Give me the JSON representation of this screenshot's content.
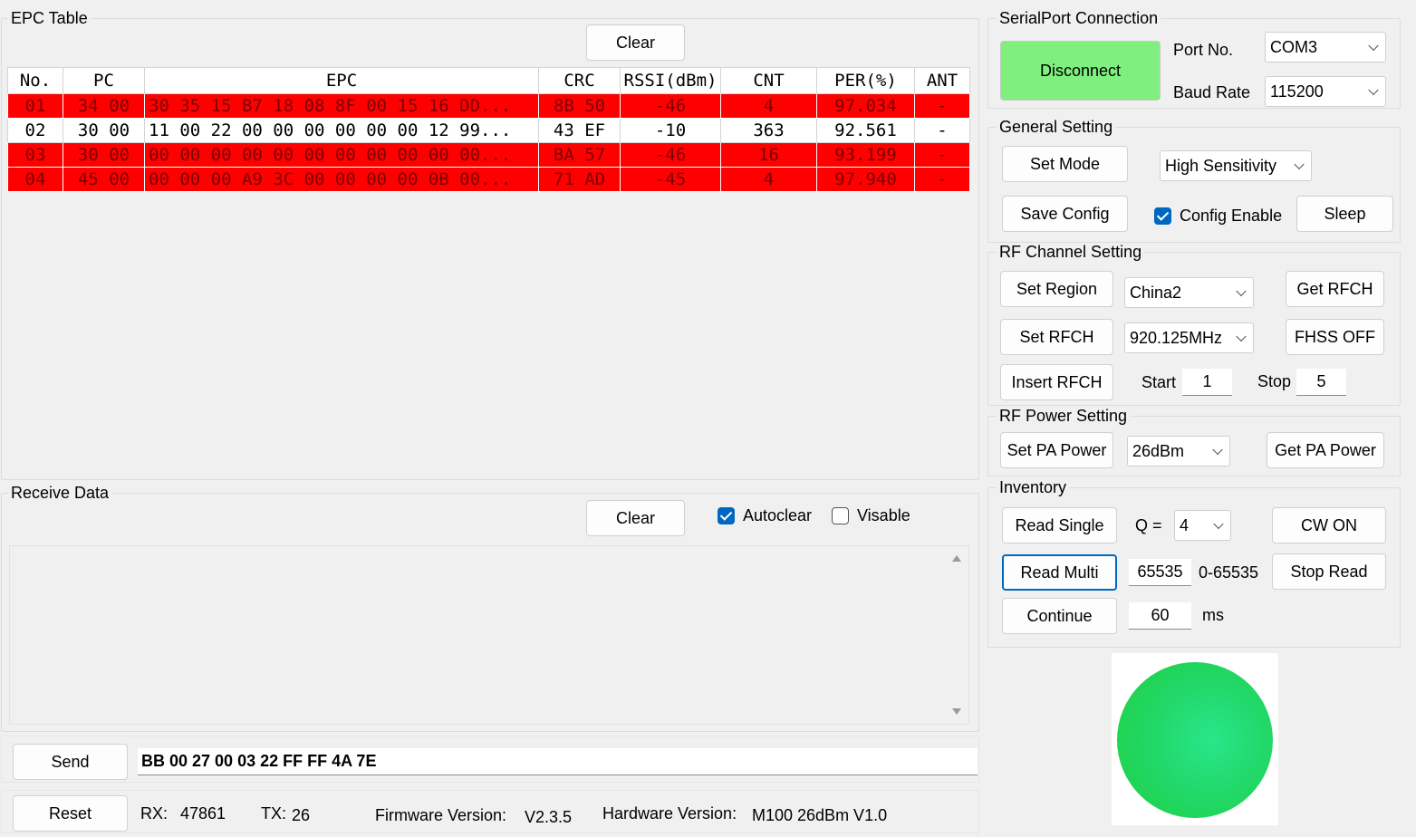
{
  "epc_table": {
    "title": "EPC Table",
    "clear_label": "Clear",
    "columns": [
      "No.",
      "PC",
      "EPC",
      "CRC",
      "RSSI(dBm)",
      "CNT",
      "PER(%)",
      "ANT"
    ],
    "rows": [
      {
        "no": "01",
        "pc": "34 00",
        "epc": "30 35 15 B7 18 08 8F 00 15 16 DD...",
        "crc": "8B 50",
        "rssi": "-46",
        "cnt": "4",
        "per": "97.034",
        "ant": "-",
        "highlight": "red"
      },
      {
        "no": "02",
        "pc": "30 00",
        "epc": "11 00 22 00 00 00 00 00 00 12 99...",
        "crc": "43 EF",
        "rssi": "-10",
        "cnt": "363",
        "per": "92.561",
        "ant": "-",
        "highlight": "none"
      },
      {
        "no": "03",
        "pc": "30 00",
        "epc": "00 00 00 00 00 00 00 00 00 00 00...",
        "crc": "BA 57",
        "rssi": "-46",
        "cnt": "16",
        "per": "93.199",
        "ant": "-",
        "highlight": "red"
      },
      {
        "no": "04",
        "pc": "45 00",
        "epc": "00 00 00 A9 3C 00 00 00 00 0B 00...",
        "crc": "71 AD",
        "rssi": "-45",
        "cnt": "4",
        "per": "97.940",
        "ant": "-",
        "highlight": "red"
      }
    ]
  },
  "receive_data": {
    "title": "Receive Data",
    "clear_label": "Clear",
    "autoclear_label": "Autoclear",
    "autoclear_checked": true,
    "visable_label": "Visable",
    "visable_checked": false,
    "content": ""
  },
  "send": {
    "send_label": "Send",
    "command": "BB 00 27 00 03 22 FF FF 4A 7E"
  },
  "status_bar": {
    "reset_label": "Reset",
    "rx_label": "RX:",
    "rx_value": "47861",
    "tx_label": "TX:",
    "tx_value": "26",
    "firmware_label": "Firmware Version:",
    "firmware_value": "V2.3.5",
    "hardware_label": "Hardware Version:",
    "hardware_value": "M100 26dBm V1.0"
  },
  "serial": {
    "title": "SerialPort Connection",
    "disconnect_label": "Disconnect",
    "port_label": "Port No.",
    "port_value": "COM3",
    "baud_label": "Baud Rate",
    "baud_value": "115200"
  },
  "general": {
    "title": "General Setting",
    "set_mode_label": "Set Mode",
    "mode_value": "High Sensitivity",
    "save_config_label": "Save Config",
    "config_enable_label": "Config Enable",
    "config_enable_checked": true,
    "sleep_label": "Sleep"
  },
  "rf_channel": {
    "title": "RF Channel Setting",
    "set_region_label": "Set Region",
    "region_value": "China2",
    "get_rfch_label": "Get RFCH",
    "set_rfch_label": "Set RFCH",
    "rfch_value": "920.125MHz",
    "fhss_label": "FHSS OFF",
    "insert_rfch_label": "Insert RFCH",
    "start_label": "Start",
    "start_value": "1",
    "stop_label": "Stop",
    "stop_value": "5"
  },
  "rf_power": {
    "title": "RF Power Setting",
    "set_pa_label": "Set PA Power",
    "pa_value": "26dBm",
    "get_pa_label": "Get PA Power"
  },
  "inventory": {
    "title": "Inventory",
    "read_single_label": "Read Single",
    "q_label": "Q =",
    "q_value": "4",
    "cw_on_label": "CW ON",
    "read_multi_label": "Read Multi",
    "multi_count_value": "65535",
    "multi_range_label": "0-65535",
    "stop_read_label": "Stop Read",
    "continue_label": "Continue",
    "continue_value": "60",
    "ms_label": "ms"
  },
  "indicator": {
    "state": "connected",
    "color": "#22d86a"
  },
  "colors": {
    "row_highlight": "#ff0000",
    "connect_button": "#7ff07f",
    "accent": "#0067c0"
  }
}
